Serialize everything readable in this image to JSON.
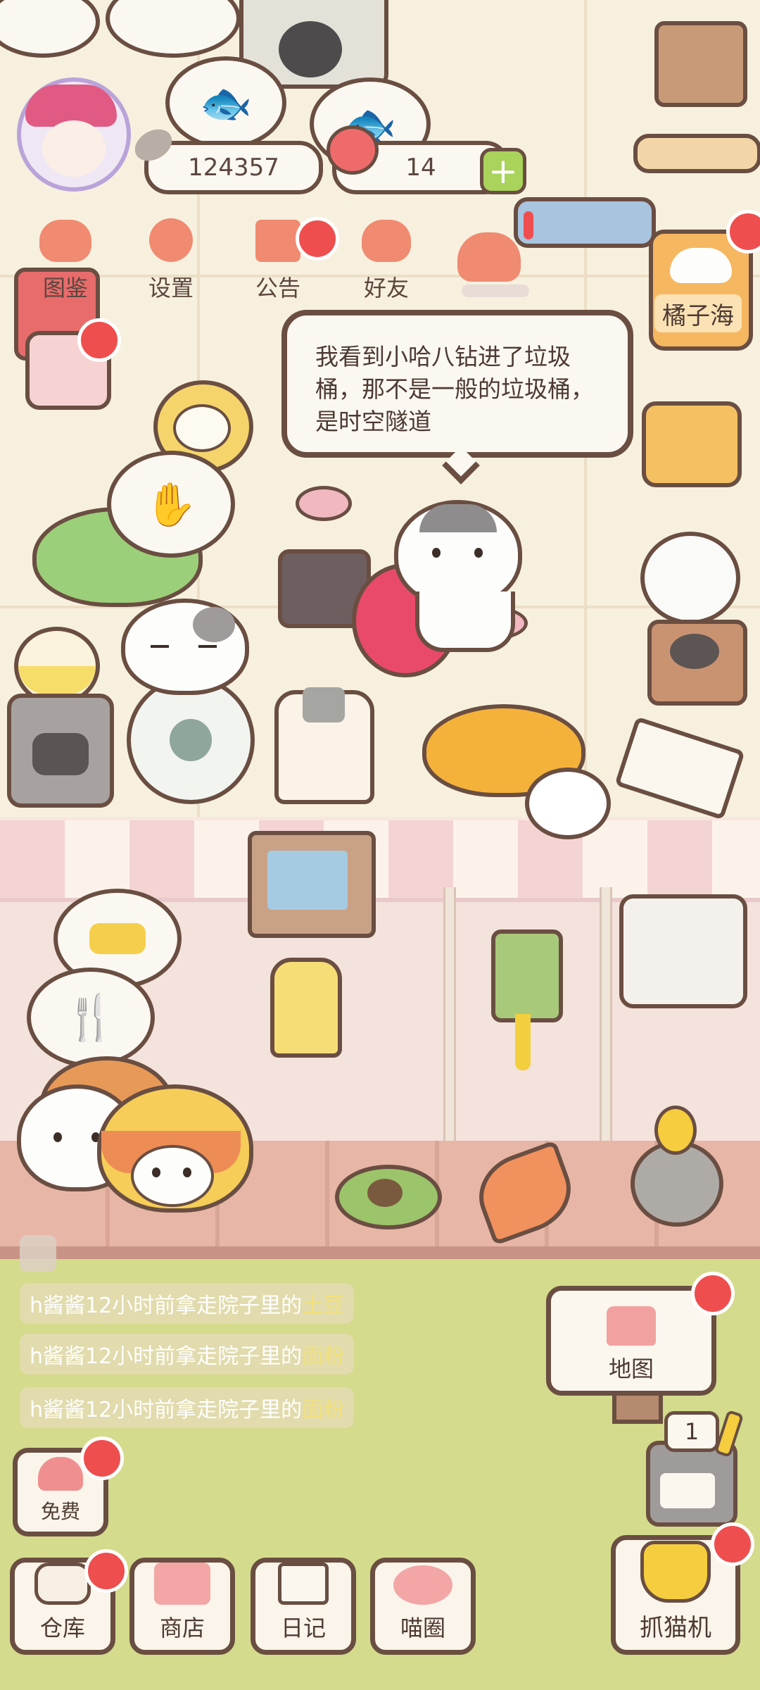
{
  "hud": {
    "coins": "124357",
    "fish": "14",
    "plus_symbol": "+"
  },
  "menu": [
    {
      "label": "图鉴",
      "icon": "cat-face-icon",
      "color": "#f08a70"
    },
    {
      "label": "设置",
      "icon": "gear-icon",
      "color": "#f08a70"
    },
    {
      "label": "公告",
      "icon": "gift-icon",
      "color": "#f08a70"
    },
    {
      "label": "好友",
      "icon": "friends-icon",
      "color": "#f08a70"
    }
  ],
  "cat_name_tag": "橘子海",
  "speech": "我看到小哈八钻进了垃圾桶，那不是一般的垃圾桶，是时空隧道",
  "notices": [
    {
      "prefix": "h酱酱12小时前拿走院子里的",
      "item": "土豆"
    },
    {
      "prefix": "h酱酱12小时前拿走院子里的",
      "item": "面粉"
    },
    {
      "prefix": "h酱酱12小时前拿走院子里的",
      "item": "面粉"
    }
  ],
  "map_button": "地图",
  "free_button": "免费",
  "slot_count": "1",
  "bottom_nav": [
    {
      "label": "仓库",
      "icon": "storage-icon"
    },
    {
      "label": "商店",
      "icon": "shop-icon"
    },
    {
      "label": "日记",
      "icon": "diary-icon"
    },
    {
      "label": "喵圈",
      "icon": "planet-cat-icon"
    }
  ],
  "claw_machine": "抓猫机",
  "colors": {
    "badge": "#ef4e4e",
    "outline": "#6a4e42",
    "lawn": "#d4db8c",
    "awning_pink": "#f4d3d3"
  }
}
